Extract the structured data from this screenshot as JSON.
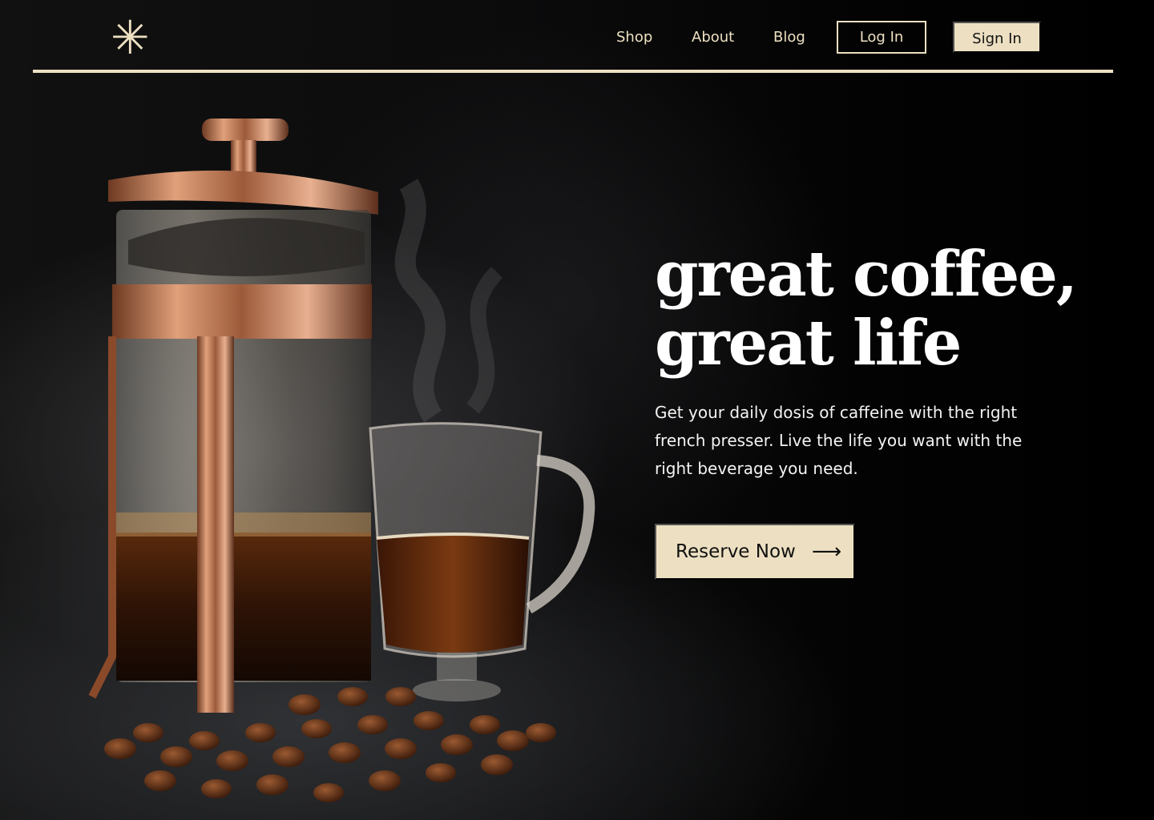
{
  "nav": {
    "logo_icon": "asterisk-icon",
    "logo_glyph": "✳",
    "links": [
      "Shop",
      "About",
      "Blog"
    ],
    "login_label": "Log In",
    "signin_label": "Sign In"
  },
  "hero": {
    "title_line1": "great coffee,",
    "title_line2": "great life",
    "subtitle": "Get your daily dosis of caffeine with the right french presser. Live the life you want with the right beverage you need.",
    "cta_label": "Reserve Now",
    "cta_icon": "arrow-right-icon",
    "cta_arrow": "⟶",
    "image": "french-press-coffee-photo"
  },
  "colors": {
    "accent": "#ede0c2",
    "background": "#000000",
    "text": "#ffffff"
  }
}
